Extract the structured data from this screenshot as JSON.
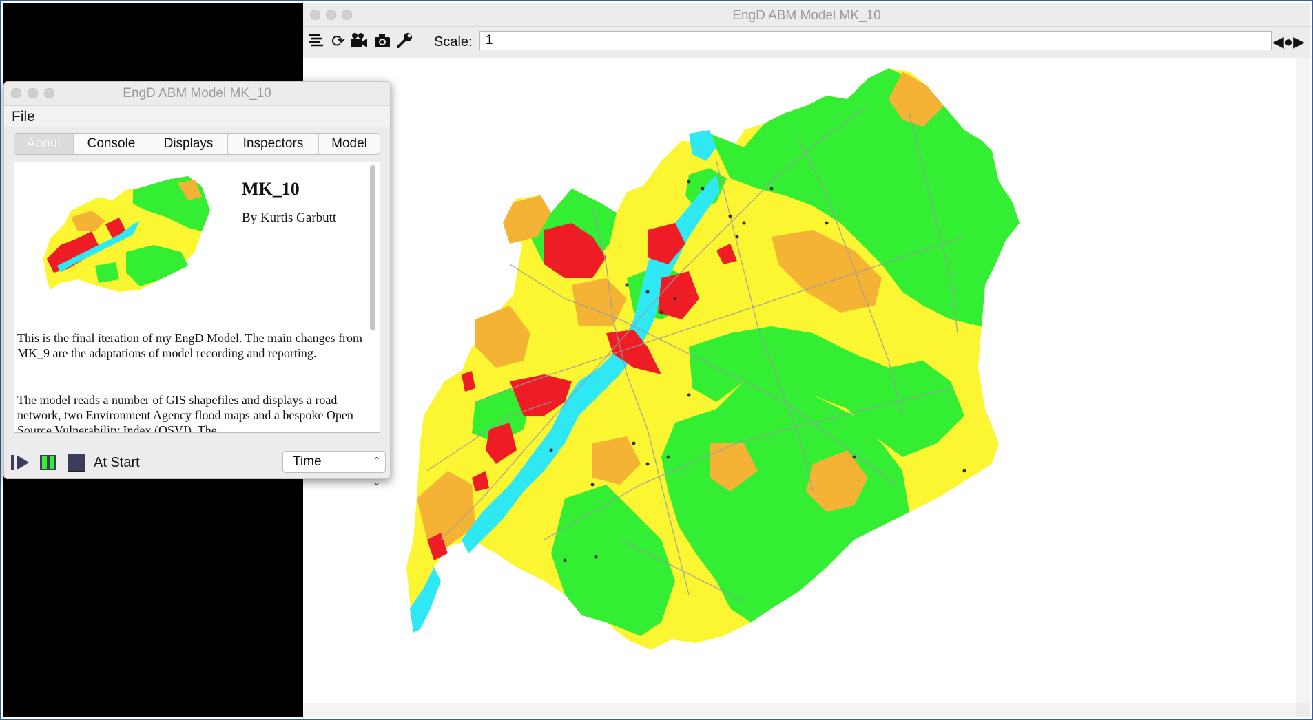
{
  "display_window": {
    "title": "EngD ABM Model MK_10",
    "toolbar": {
      "layers_icon": "layers-icon",
      "refresh_icon": "refresh-icon",
      "movie_icon": "movie-camera-icon",
      "snapshot_icon": "camera-icon",
      "options_icon": "wrench-icon",
      "scale_label": "Scale:",
      "scale_value": "1",
      "pan_icon": "pan-arrows-icon"
    },
    "map": {
      "description_icon": "gis-map",
      "colors": {
        "very_high": "#ee1c25",
        "high": "#f5b335",
        "medium": "#fbf532",
        "low": "#33ee33",
        "flood": "#2ee8f4",
        "road": "#9a9aa5",
        "agent": "#333333"
      }
    }
  },
  "console_window": {
    "title": "EngD ABM Model MK_10",
    "menu": {
      "file": "File"
    },
    "tabs": [
      {
        "label": "About",
        "active": true
      },
      {
        "label": "Console",
        "active": false
      },
      {
        "label": "Displays",
        "active": false
      },
      {
        "label": "Inspectors",
        "active": false
      },
      {
        "label": "Model",
        "active": false
      }
    ],
    "about": {
      "heading": "MK_10",
      "byline": "By Kurtis Garbutt",
      "paragraph1": "This is the final iteration of my EngD Model. The main changes from MK_9 are the adaptations of model recording and reporting.",
      "paragraph2": "The model reads a number of GIS shapefiles and displays a road network, two Environment Agency flood maps and a bespoke Open Source Vulnerability Index (OSVI). The"
    },
    "controls": {
      "play_icon": "play-icon",
      "pause_icon": "pause-icon",
      "stop_icon": "stop-icon",
      "status": "At Start",
      "time_select": "Time"
    }
  }
}
